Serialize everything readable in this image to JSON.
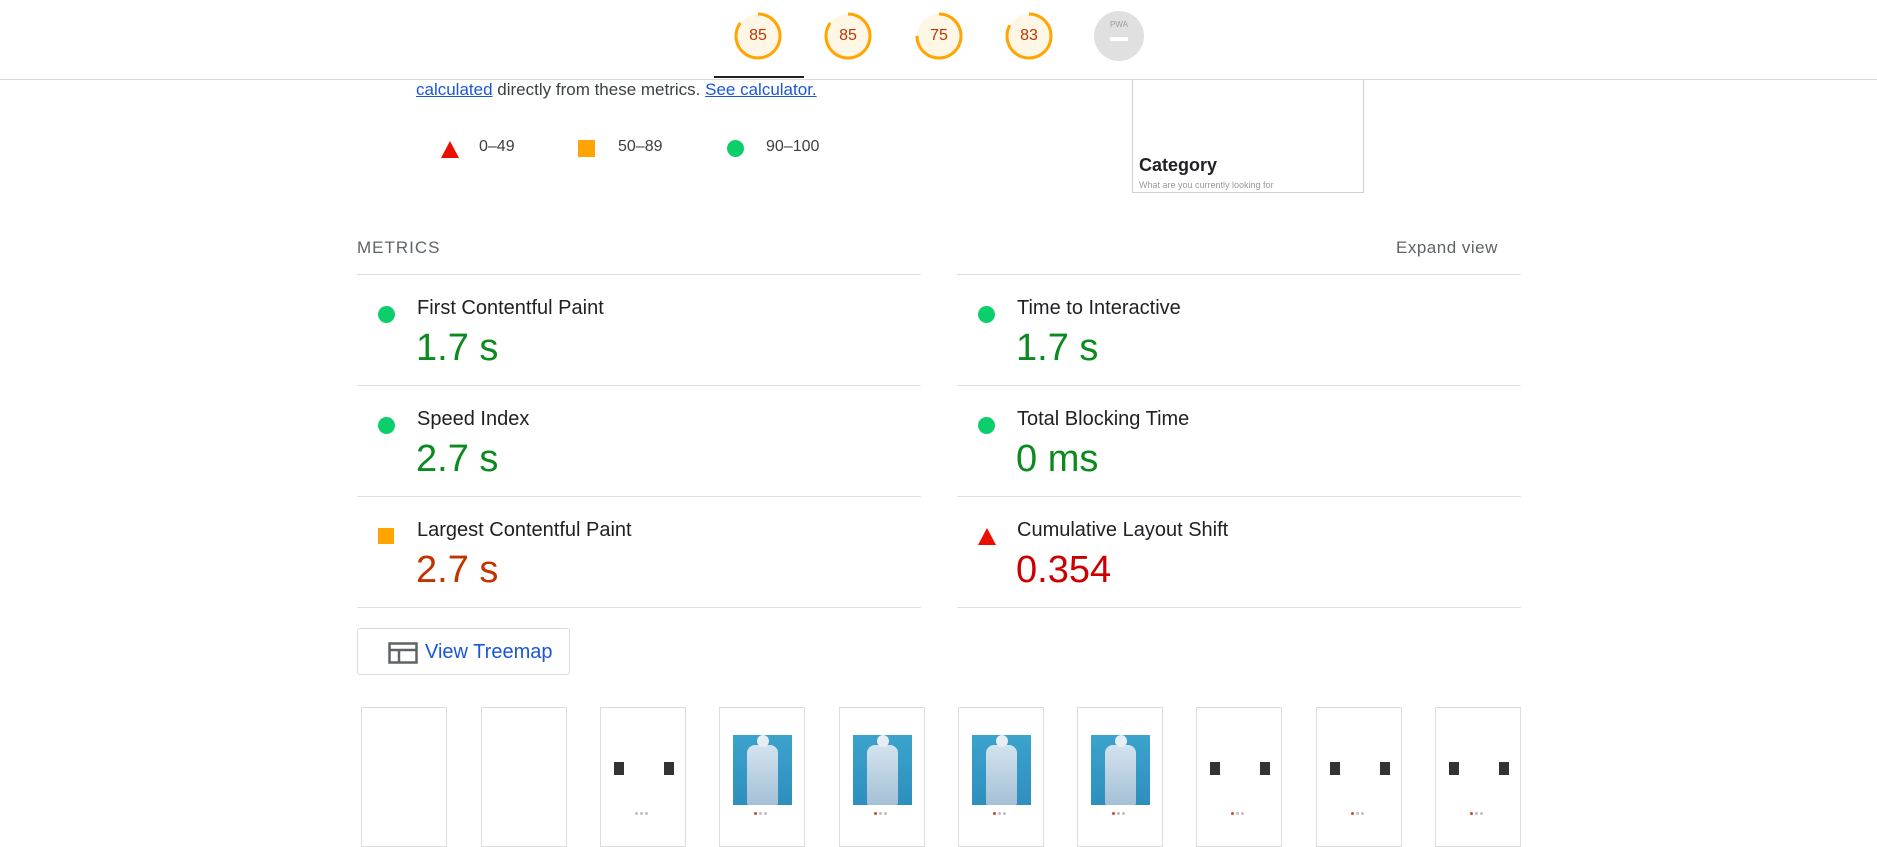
{
  "scores": [
    {
      "name": "performance",
      "value": "85",
      "fraction": 0.85
    },
    {
      "name": "accessibility",
      "value": "85",
      "fraction": 0.85
    },
    {
      "name": "best-practices",
      "value": "75",
      "fraction": 0.75
    },
    {
      "name": "seo",
      "value": "83",
      "fraction": 0.83
    }
  ],
  "pwa": {
    "label": "PWA"
  },
  "intro": {
    "link1": "calculated",
    "text": " directly from these metrics. ",
    "link2": "See calculator."
  },
  "legend": {
    "fail": "0–49",
    "average": "50–89",
    "pass": "90–100"
  },
  "screenshot": {
    "heading": "Category",
    "subtext": "What are you currently looking for"
  },
  "metrics": {
    "title": "METRICS",
    "expand": "Expand view",
    "items": [
      {
        "label": "First Contentful Paint",
        "value": "1.7 s",
        "rating": "pass"
      },
      {
        "label": "Time to Interactive",
        "value": "1.7 s",
        "rating": "pass"
      },
      {
        "label": "Speed Index",
        "value": "2.7 s",
        "rating": "pass"
      },
      {
        "label": "Total Blocking Time",
        "value": "0 ms",
        "rating": "pass"
      },
      {
        "label": "Largest Contentful Paint",
        "value": "2.7 s",
        "rating": "average"
      },
      {
        "label": "Cumulative Layout Shift",
        "value": "0.354",
        "rating": "fail"
      }
    ]
  },
  "treemap": {
    "label": "View Treemap"
  },
  "colors": {
    "pass": "#0cce6b",
    "average": "#ffa400",
    "fail": "#eb0f00",
    "link": "#1a57d8"
  }
}
